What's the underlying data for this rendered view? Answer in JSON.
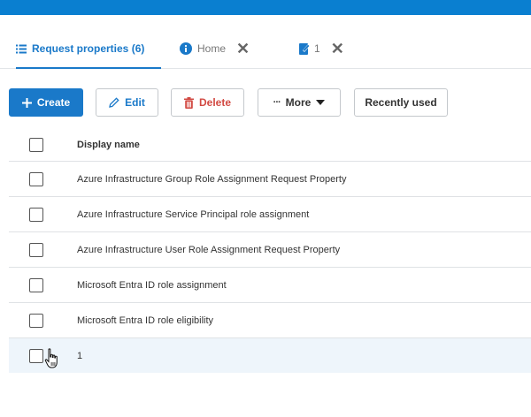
{
  "tabs": [
    {
      "label": "Request properties (6)",
      "icon": "list-icon",
      "active": true
    },
    {
      "label": "Home",
      "icon": "info-icon",
      "closable": true
    },
    {
      "label": "1",
      "icon": "edit-document-icon",
      "closable": true
    }
  ],
  "toolbar": {
    "create_label": "Create",
    "edit_label": "Edit",
    "delete_label": "Delete",
    "more_label": "More",
    "recently_used_label": "Recently used"
  },
  "table": {
    "columns": [
      "Display name"
    ],
    "rows": [
      "Azure Infrastructure Group Role Assignment Request Property",
      "Azure Infrastructure Service Principal role assignment",
      "Azure Infrastructure User Role Assignment Request Property",
      "Microsoft Entra ID role assignment",
      "Microsoft Entra ID role eligibility",
      "1"
    ]
  },
  "colors": {
    "accent": "#1a79c9",
    "topbar": "#0a7fd0",
    "danger": "#d24a43",
    "hover_row": "#eef5fb"
  }
}
